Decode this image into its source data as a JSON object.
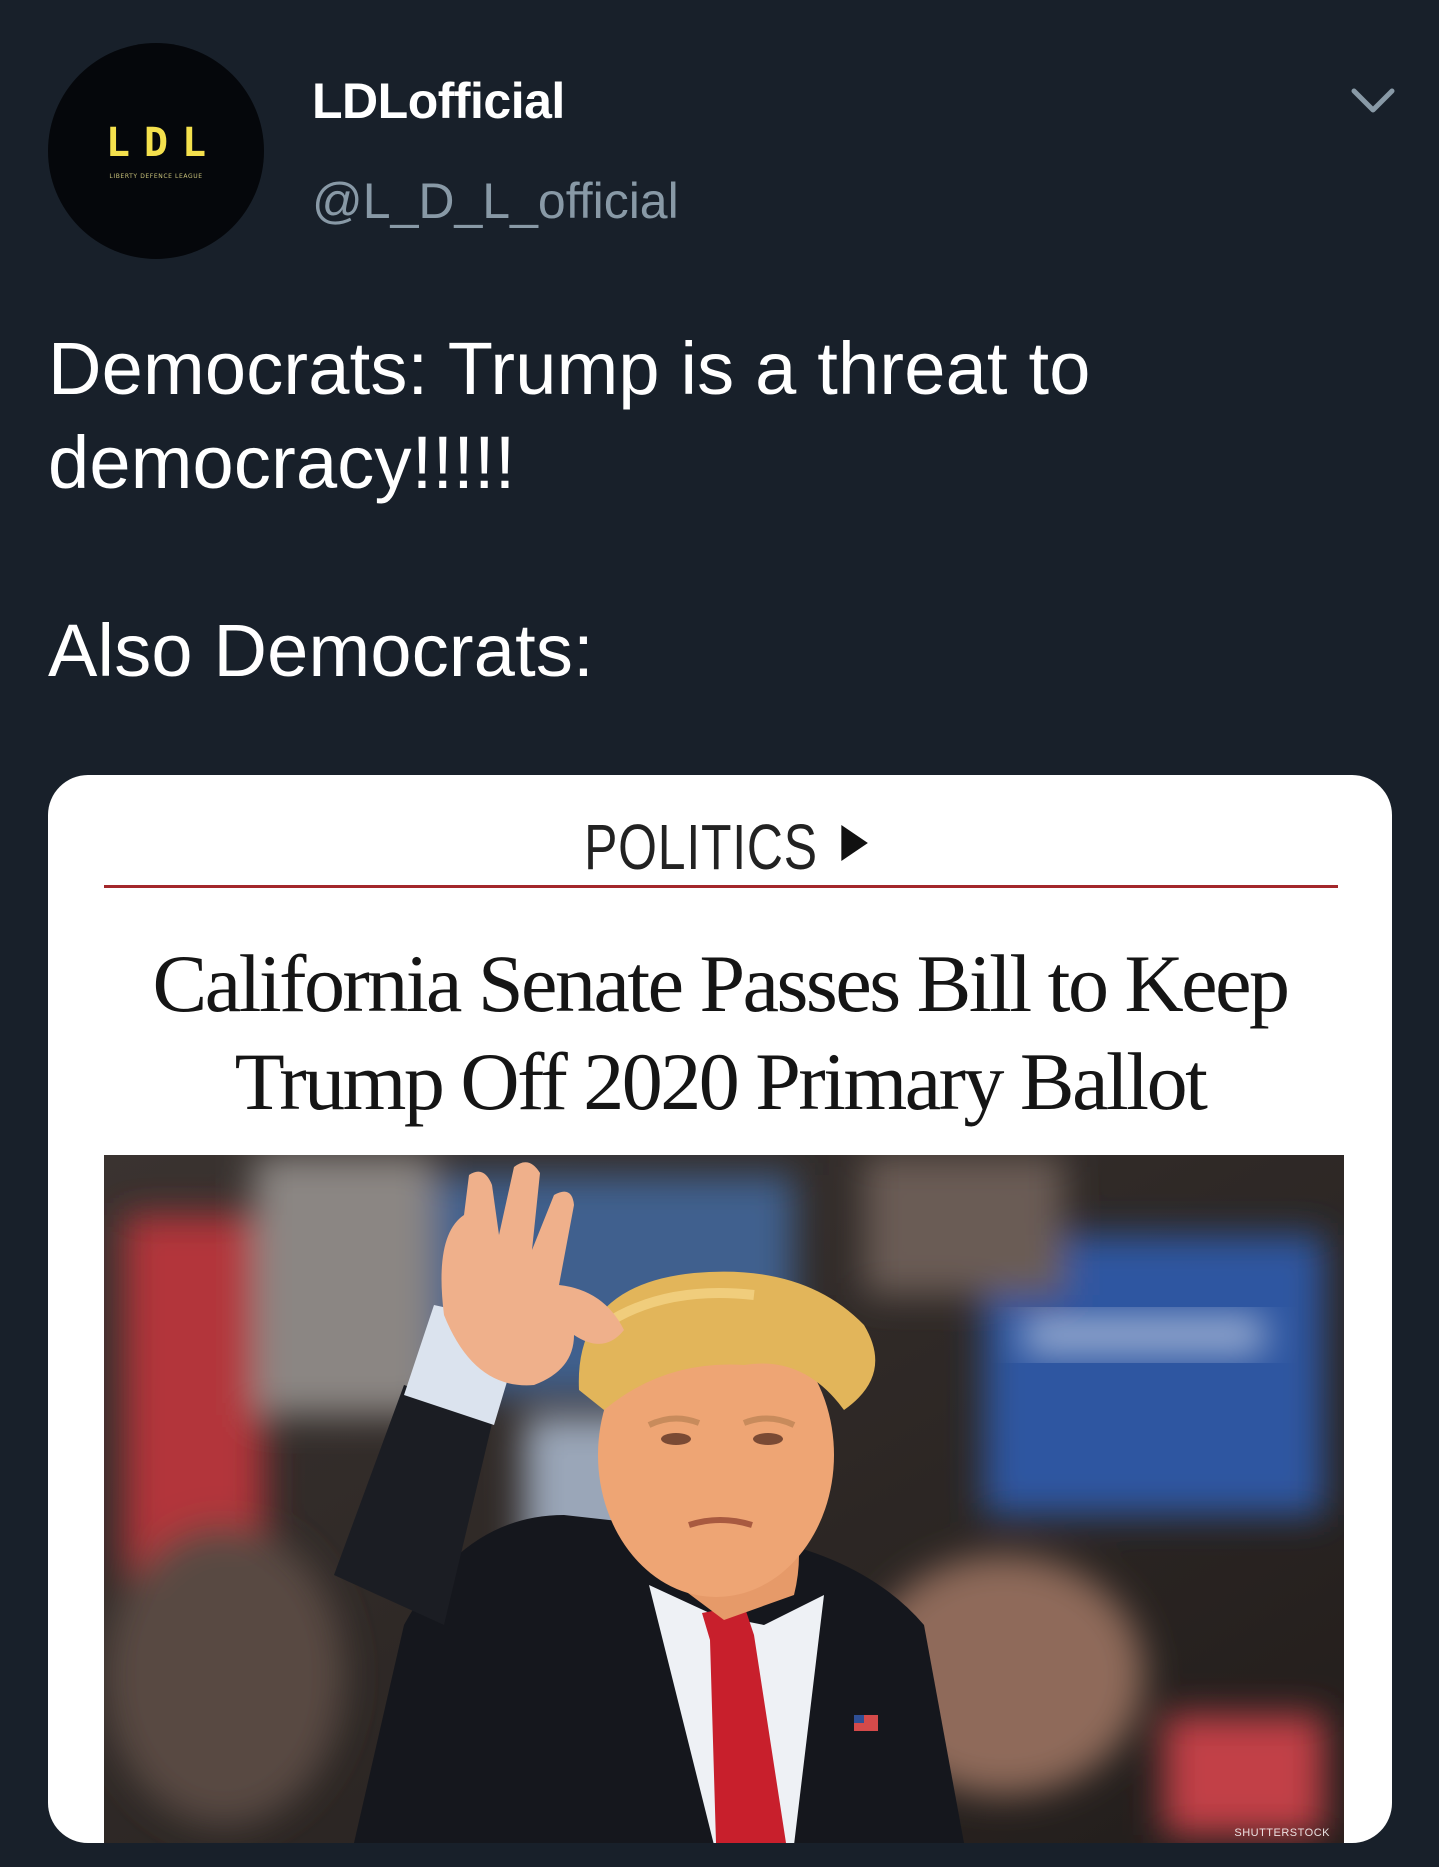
{
  "author": {
    "display_name": "LDLofficial",
    "handle": "@L_D_L_official",
    "avatar_text": "LDL",
    "avatar_subtext": "LIBERTY DEFENCE LEAGUE"
  },
  "tweet": {
    "text": "Democrats: Trump is a threat to\ndemocracy!!!!!\n\nAlso Democrats:"
  },
  "card": {
    "section_label": "POLITICS",
    "headline": "California Senate Passes Bill to Keep\nTrump Off 2020 Primary Ballot",
    "photo_credit": "SHUTTERSTOCK"
  },
  "icons": {
    "menu": "chevron-down-icon",
    "section": "play-arrow-icon"
  },
  "colors": {
    "background": "#18202a",
    "handle": "#8899a6",
    "rule": "#a3282b",
    "avatar_accent": "#f4e04d"
  }
}
